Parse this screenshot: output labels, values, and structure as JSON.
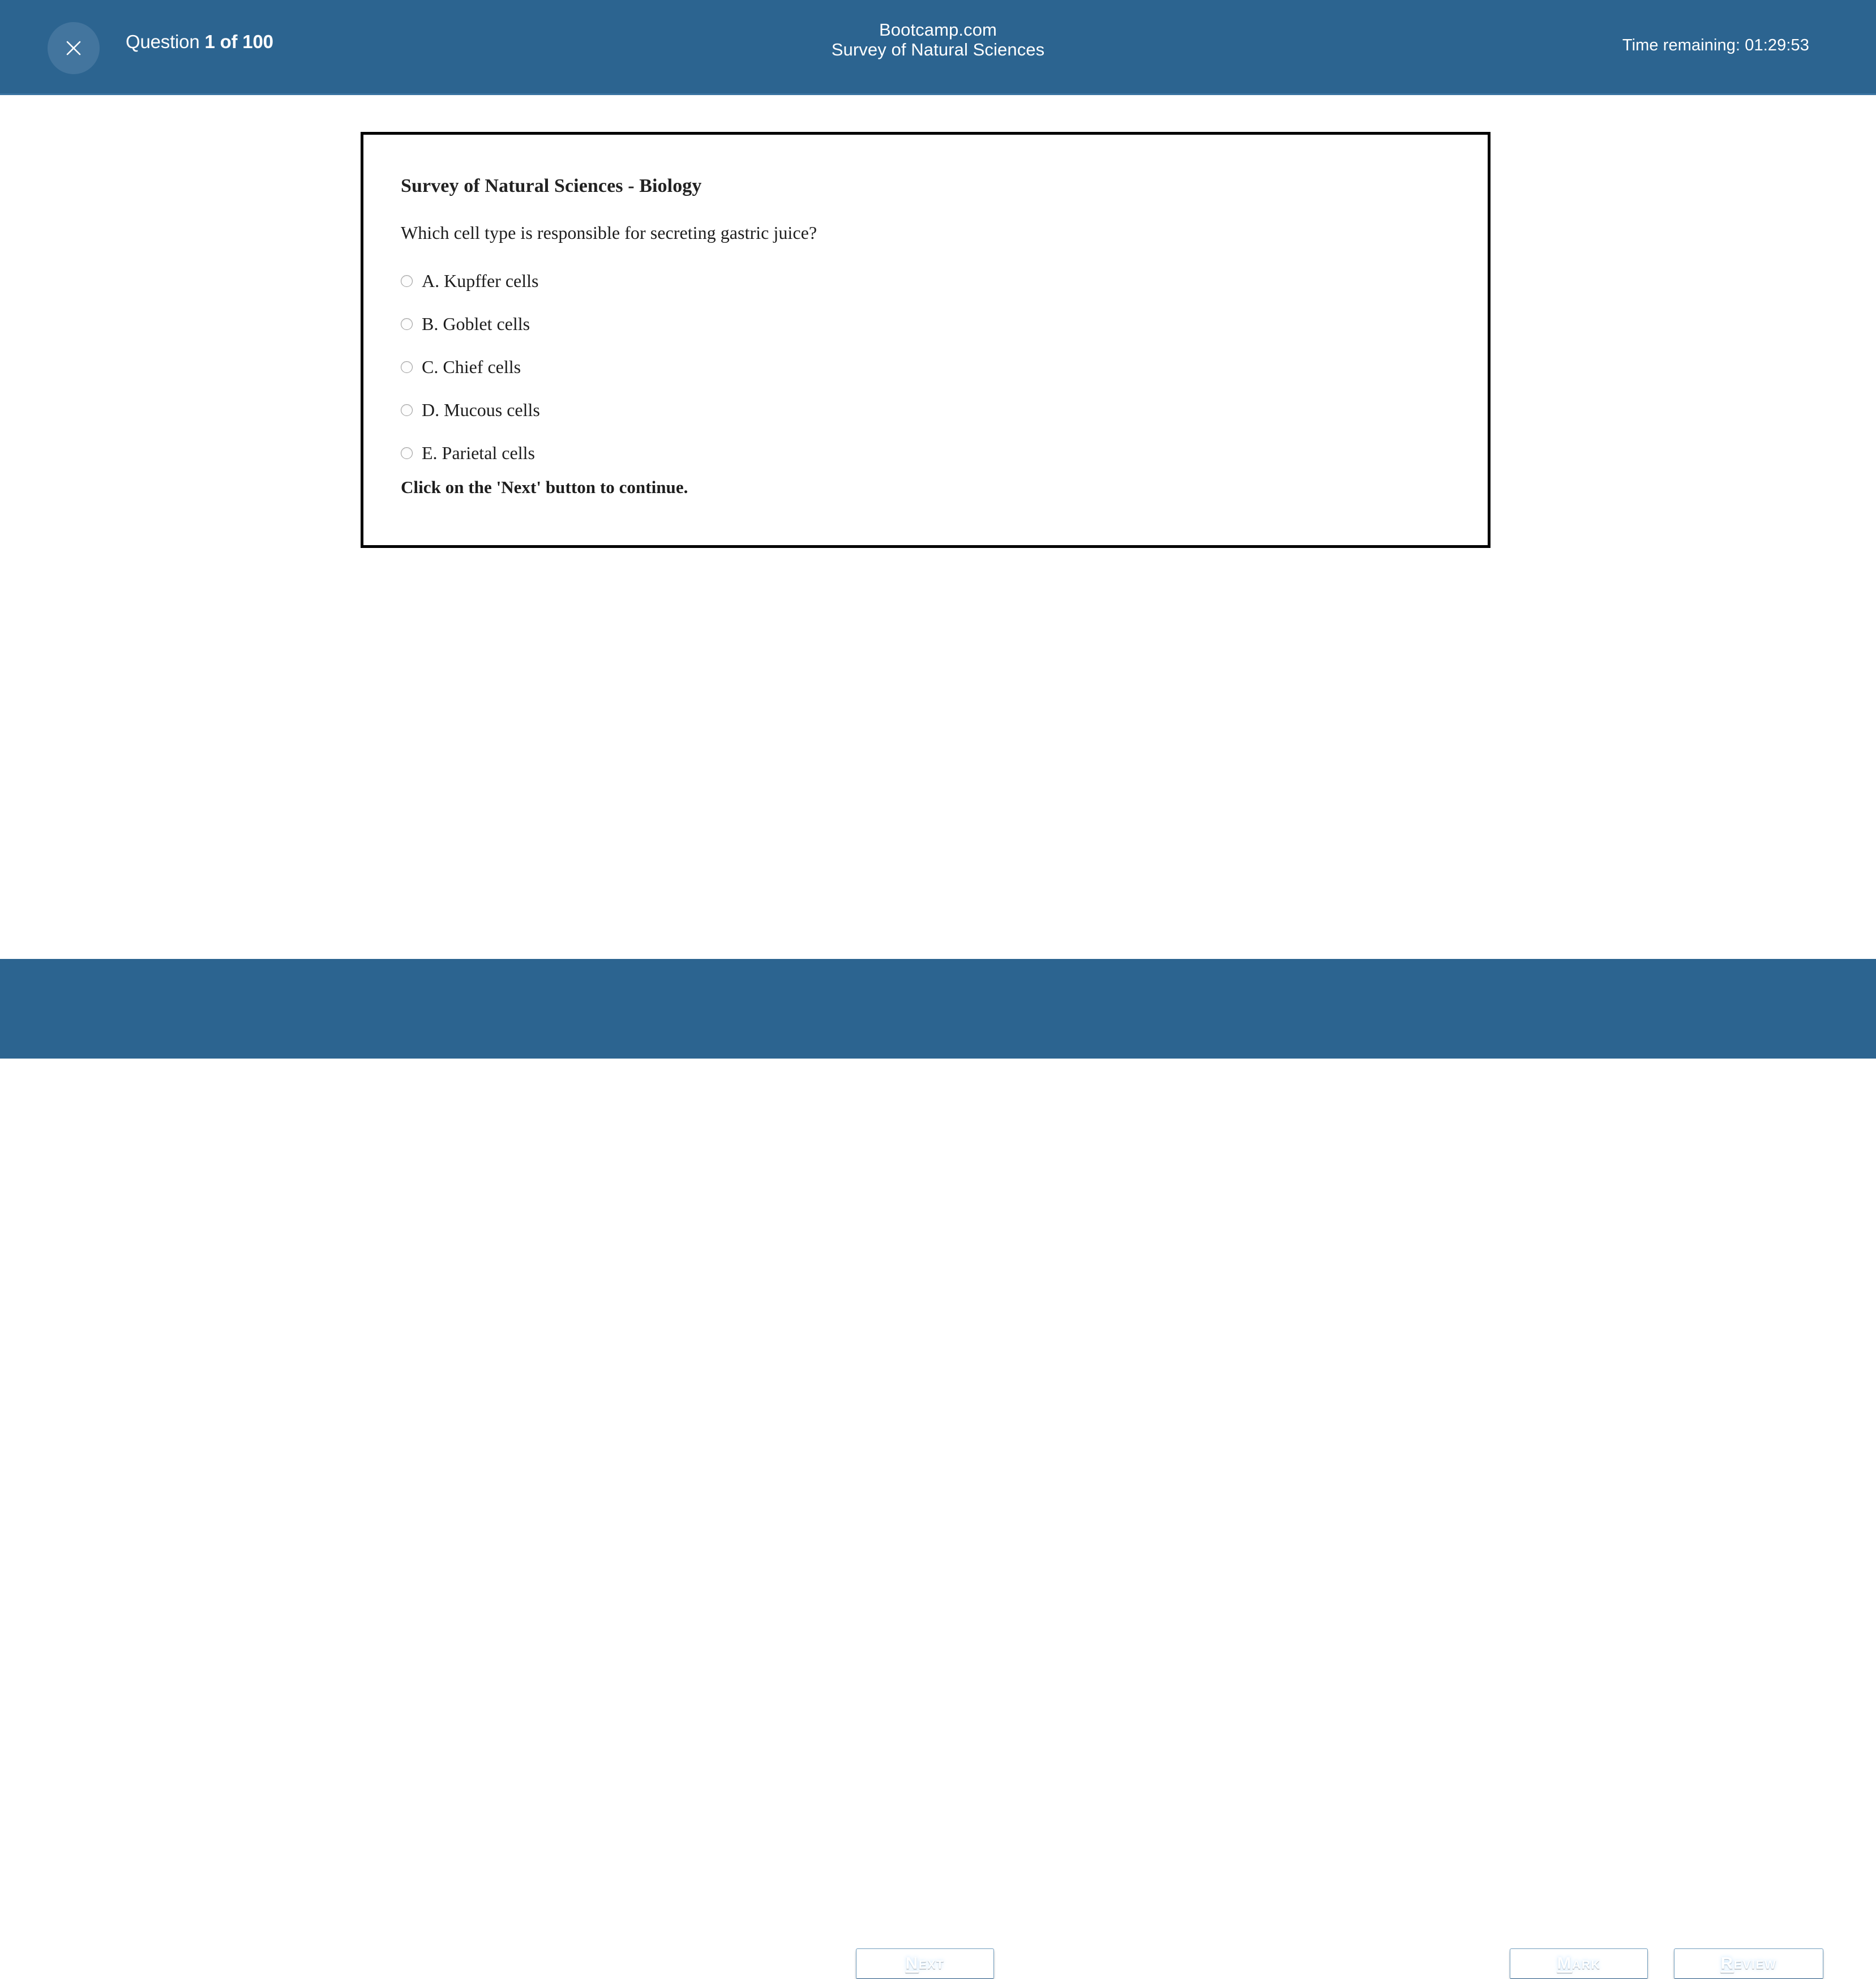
{
  "header": {
    "close_icon": "close-x-icon",
    "question_counter_lead": "Question ",
    "question_counter_value": "1 of 100",
    "brand": "Bootcamp.com",
    "exam_name": "Survey of Natural Sciences",
    "time_remaining": "Time remaining: 01:29:53",
    "bar_color": "#2c6490",
    "close_circle_color": "#43759e"
  },
  "question_card": {
    "section_heading": "Survey of Natural Sciences - Biology",
    "stem": "Which cell type is responsible for secreting gastric juice?",
    "options": [
      {
        "id": "A",
        "label": "A. Kupffer cells",
        "selected": false
      },
      {
        "id": "B",
        "label": "B. Goblet cells",
        "selected": false
      },
      {
        "id": "C",
        "label": "C. Chief cells",
        "selected": false
      },
      {
        "id": "D",
        "label": "D. Mucous cells",
        "selected": false
      },
      {
        "id": "E",
        "label": "E. Parietal cells",
        "selected": false
      }
    ],
    "instruction": "Click on the 'Next' button to continue.",
    "border_color": "#000000"
  },
  "footer": {
    "bar_color": "#2c6490",
    "buttons": [
      {
        "name": "next",
        "accesskey": "N",
        "rest": "ext"
      },
      {
        "name": "mark",
        "accesskey": "M",
        "rest": "ark"
      },
      {
        "name": "review",
        "accesskey": "R",
        "rest": "eview"
      }
    ]
  }
}
